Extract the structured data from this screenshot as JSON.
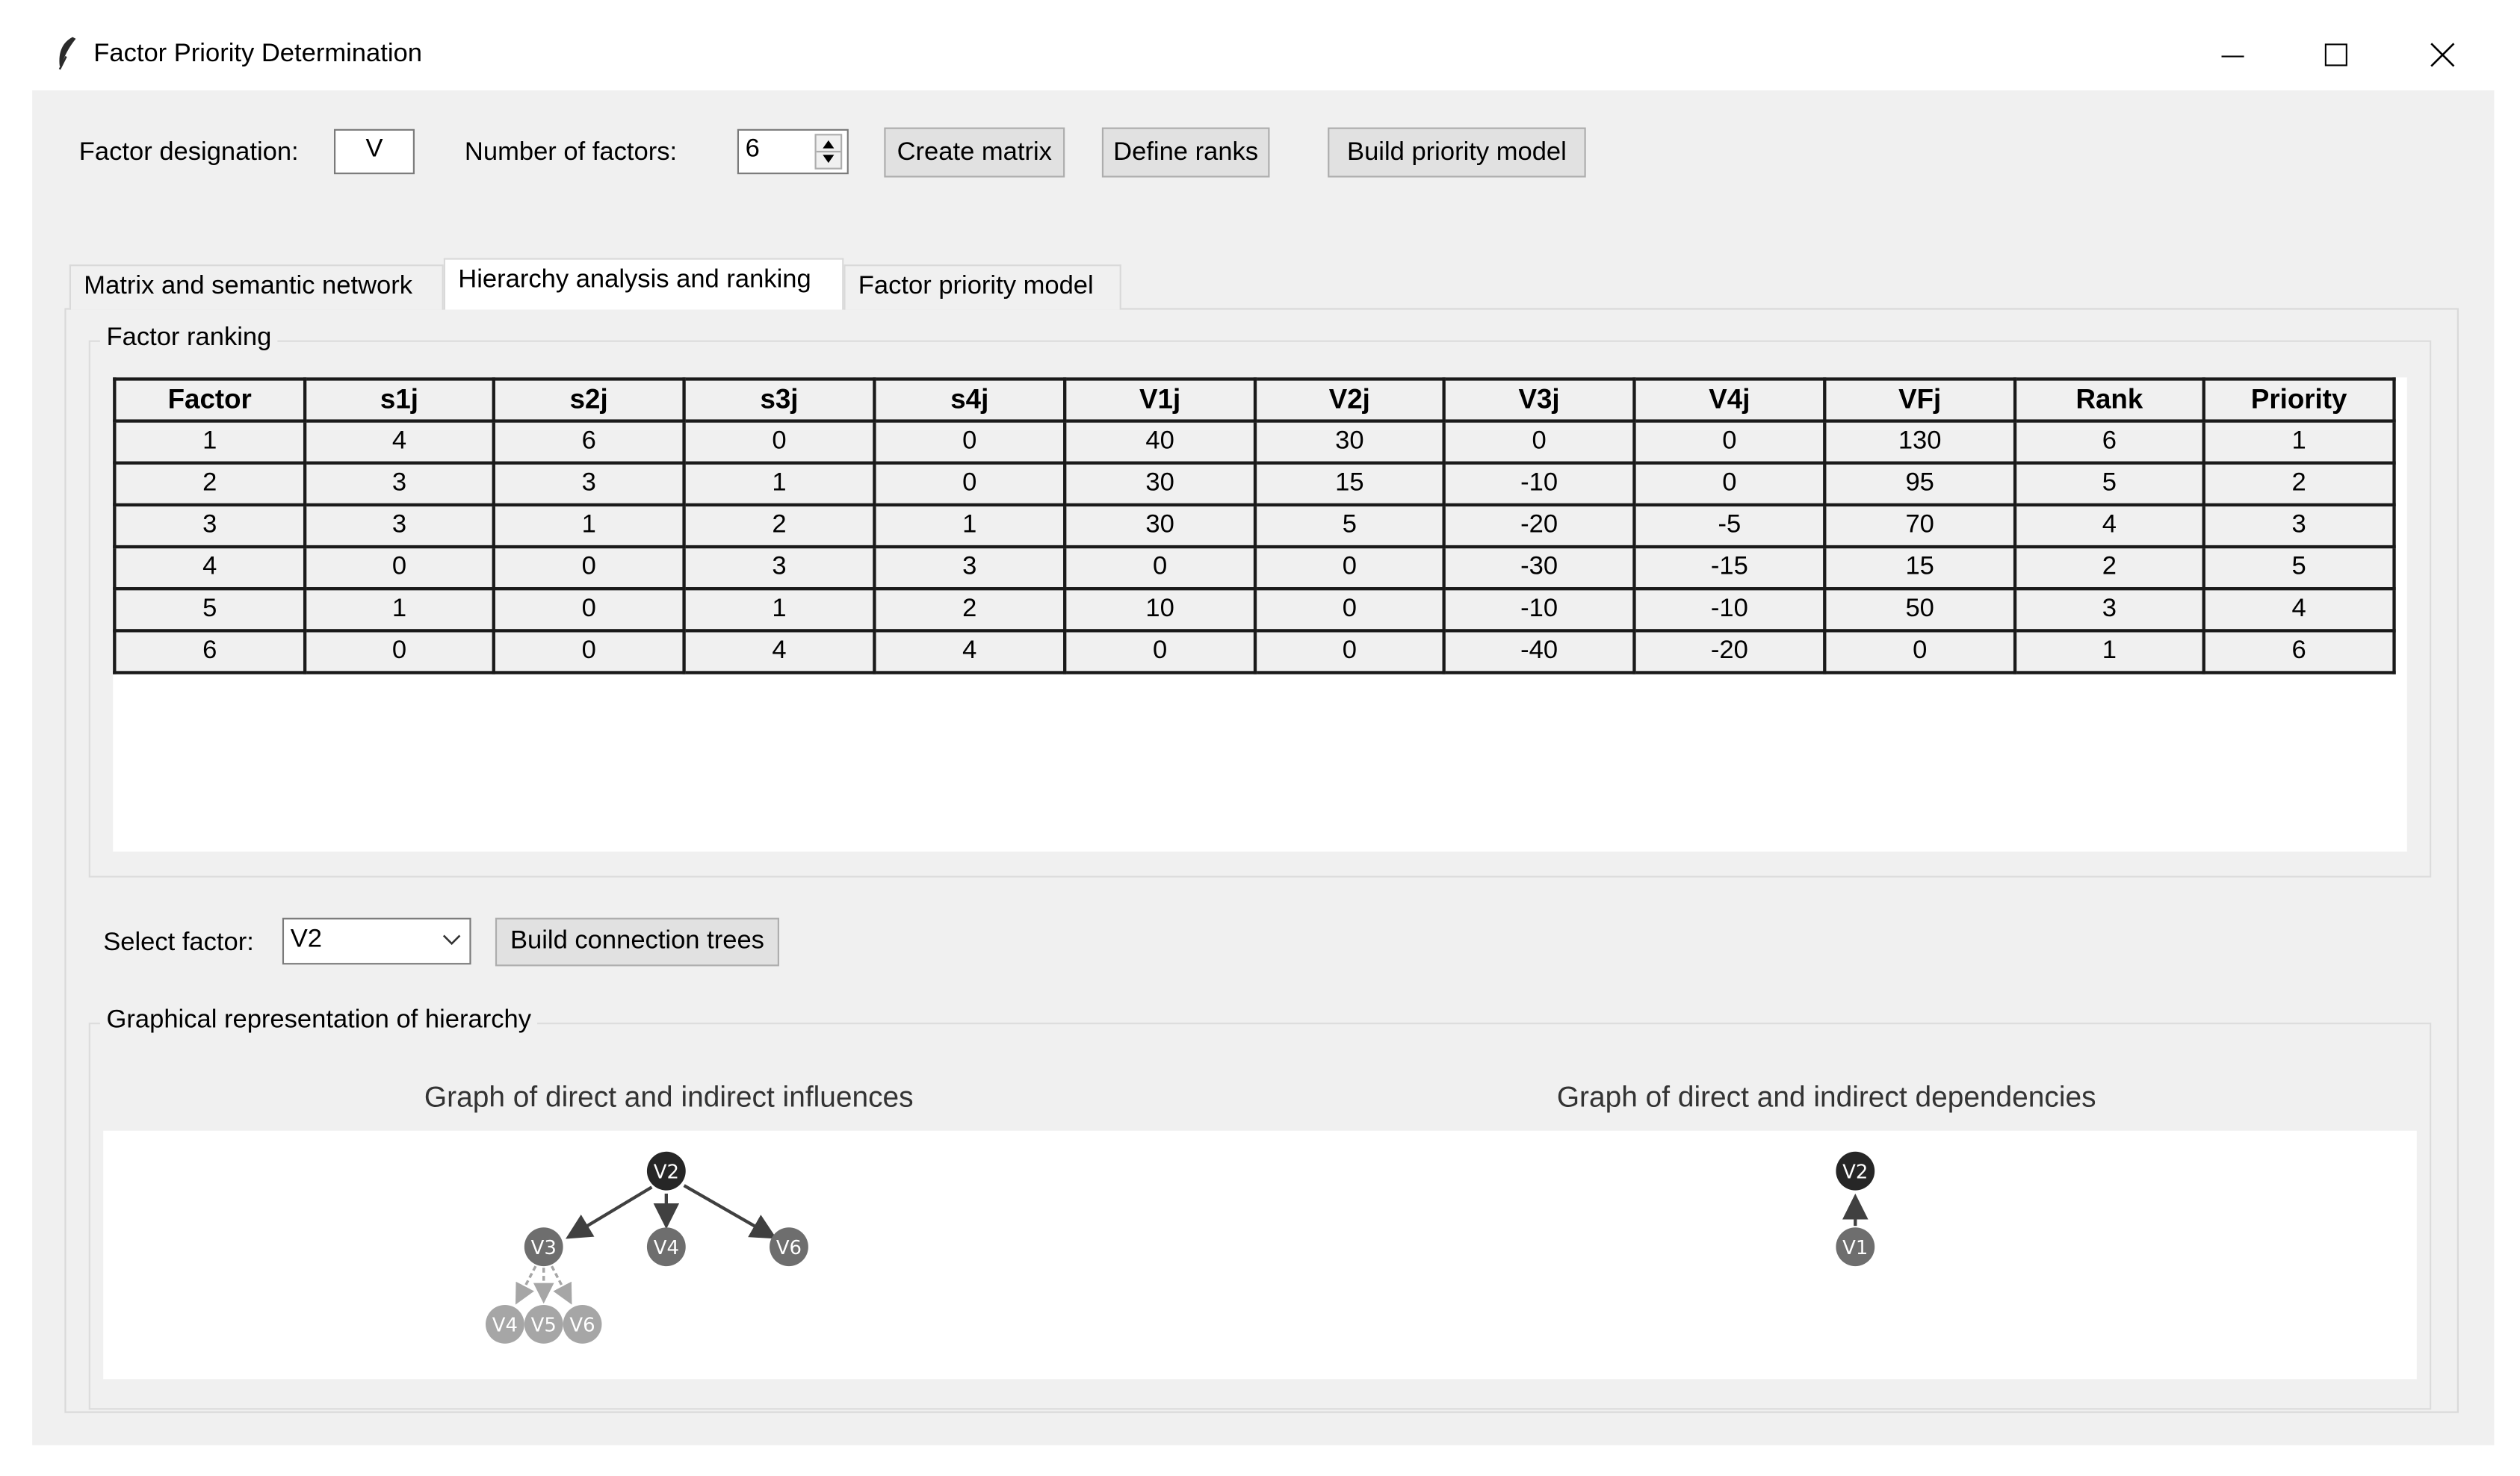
{
  "window": {
    "title": "Factor Priority Determination",
    "controls": [
      "minimize",
      "maximize",
      "close"
    ]
  },
  "toolbar": {
    "designation_label": "Factor designation:",
    "designation_value": "V",
    "count_label": "Number of factors:",
    "count_value": "6",
    "create_matrix": "Create matrix",
    "define_ranks": "Define ranks",
    "build_model": "Build priority model"
  },
  "tabs": [
    {
      "label": "Matrix and semantic network",
      "active": false
    },
    {
      "label": "Hierarchy analysis and ranking",
      "active": true
    },
    {
      "label": "Factor priority model",
      "active": false
    }
  ],
  "ranking": {
    "group_title": "Factor ranking",
    "columns": [
      "Factor",
      "s1j",
      "s2j",
      "s3j",
      "s4j",
      "V1j",
      "V2j",
      "V3j",
      "V4j",
      "VFj",
      "Rank",
      "Priority"
    ],
    "rows": [
      [
        "1",
        "4",
        "6",
        "0",
        "0",
        "40",
        "30",
        "0",
        "0",
        "130",
        "6",
        "1"
      ],
      [
        "2",
        "3",
        "3",
        "1",
        "0",
        "30",
        "15",
        "-10",
        "0",
        "95",
        "5",
        "2"
      ],
      [
        "3",
        "3",
        "1",
        "2",
        "1",
        "30",
        "5",
        "-20",
        "-5",
        "70",
        "4",
        "3"
      ],
      [
        "4",
        "0",
        "0",
        "3",
        "3",
        "0",
        "0",
        "-30",
        "-15",
        "15",
        "2",
        "5"
      ],
      [
        "5",
        "1",
        "0",
        "1",
        "2",
        "10",
        "0",
        "-10",
        "-10",
        "50",
        "3",
        "4"
      ],
      [
        "6",
        "0",
        "0",
        "4",
        "4",
        "0",
        "0",
        "-40",
        "-20",
        "0",
        "1",
        "6"
      ]
    ]
  },
  "select": {
    "label": "Select factor:",
    "value": "V2",
    "build_trees": "Build connection trees"
  },
  "hierarchy": {
    "group_title": "Graphical representation of hierarchy",
    "influences_title": "Graph of direct and indirect influences",
    "dependencies_title": "Graph of direct and indirect dependencies",
    "influences_nodes": [
      "V2",
      "V3",
      "V4",
      "V6",
      "V4",
      "V5",
      "V6"
    ],
    "dependencies_nodes": [
      "V2",
      "V1"
    ],
    "colors": {
      "level0": "#262626",
      "level1": "#6e6e6e",
      "level2": "#a6a6a6"
    }
  }
}
